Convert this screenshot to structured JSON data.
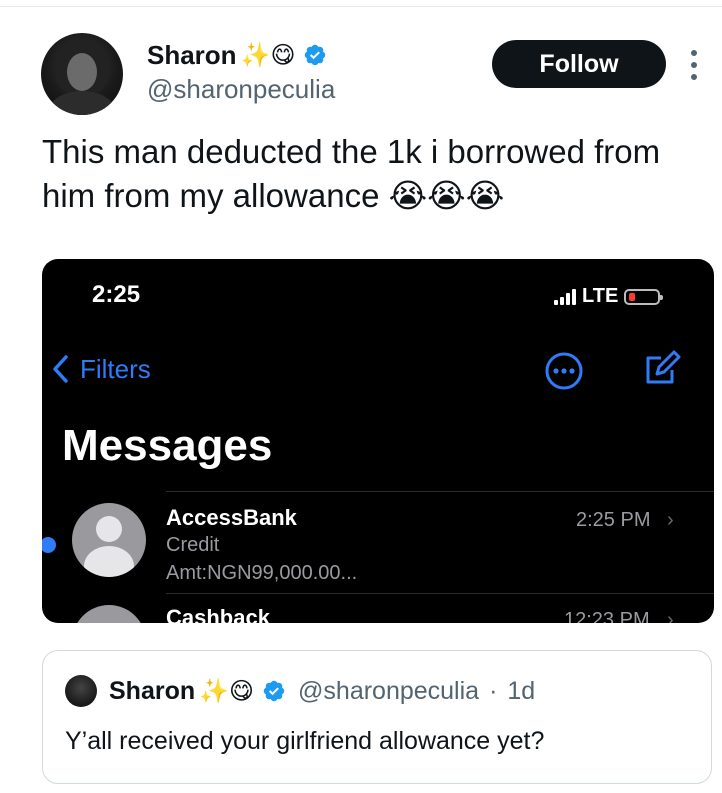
{
  "tweet": {
    "author_name": "Sharon",
    "author_emojis": "✨😋",
    "handle": "@sharonpeculia",
    "follow_label": "Follow",
    "text": "This man deducted the 1k i borrowed from him from my allowance 😭😭😭"
  },
  "screenshot": {
    "time": "2:25",
    "network": "LTE",
    "back_label": "Filters",
    "title": "Messages",
    "messages": [
      {
        "sender": "AccessBank",
        "line1": "Credit",
        "line2": "Amt:NGN99,000.00...",
        "time": "2:25 PM",
        "chevron": "›",
        "unread": true
      },
      {
        "sender": "Cashback",
        "time": "12:23 PM",
        "chevron": "›"
      }
    ],
    "accent_color": "#2f7cf6"
  },
  "quote": {
    "author_name": "Sharon",
    "author_emojis": "✨😋",
    "handle": "@sharonpeculia",
    "separator": "·",
    "age": "1d",
    "text": "Y’all received your girlfriend allowance yet?"
  },
  "icons": [
    "verified-badge-icon",
    "more-dots-icon",
    "chevron-left-icon",
    "ellipsis-circle-icon",
    "compose-icon",
    "signal-bars-icon",
    "battery-icon",
    "chevron-right-icon"
  ],
  "colors": {
    "verified": "#1d9bf0",
    "follow_bg": "#0f1419",
    "text_secondary": "#536471"
  }
}
